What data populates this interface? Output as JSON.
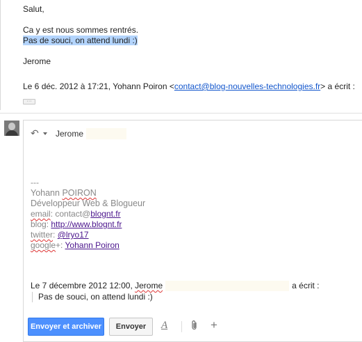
{
  "message": {
    "greeting": "Salut,",
    "line1": "Ca y est nous sommes rentrés.",
    "line2": "Pas de souci, on attend lundi :)",
    "signoff": "Jerome",
    "quote_prefix": "Le 6 déc. 2012 à 17:21, Yohann Poiron <",
    "quote_email": "contact@blog-nouvelles-technologies.fr",
    "quote_suffix": "> a écrit :",
    "more_label": "···"
  },
  "compose": {
    "recipient": "Jerome",
    "signature": {
      "dashes": "---",
      "name_first": "Yohann ",
      "name_last": "POIRON",
      "role": "Développeur Web & Blogueur",
      "email_label": "email",
      "email_rest": ": contact@",
      "email_domain": "blognt.fr",
      "blog_label": "blog: ",
      "blog_url": "http://www.blognt.fr",
      "twitter_label": "twitter",
      "twitter_sep": ": ",
      "twitter_handle": "@lryo17",
      "google_label": "google",
      "google_sep": "+: ",
      "google_name": "Yohann Poiron"
    },
    "quote_date": "Le 7 décembre 2012 12:00, ",
    "quote_name": "Jerome",
    "quote_suffix": "a écrit :",
    "quoted_text": "Pas de souci, on attend lundi :)"
  },
  "toolbar": {
    "send_label": "Envoyer et archiver",
    "save_label": "Envoyer",
    "format_icon": "A",
    "attach_icon": "paperclip-icon",
    "more_icon": "+"
  },
  "colors": {
    "highlight": "#b3d4fc",
    "link": "#1155cc",
    "send_button": "#4d90fe"
  }
}
